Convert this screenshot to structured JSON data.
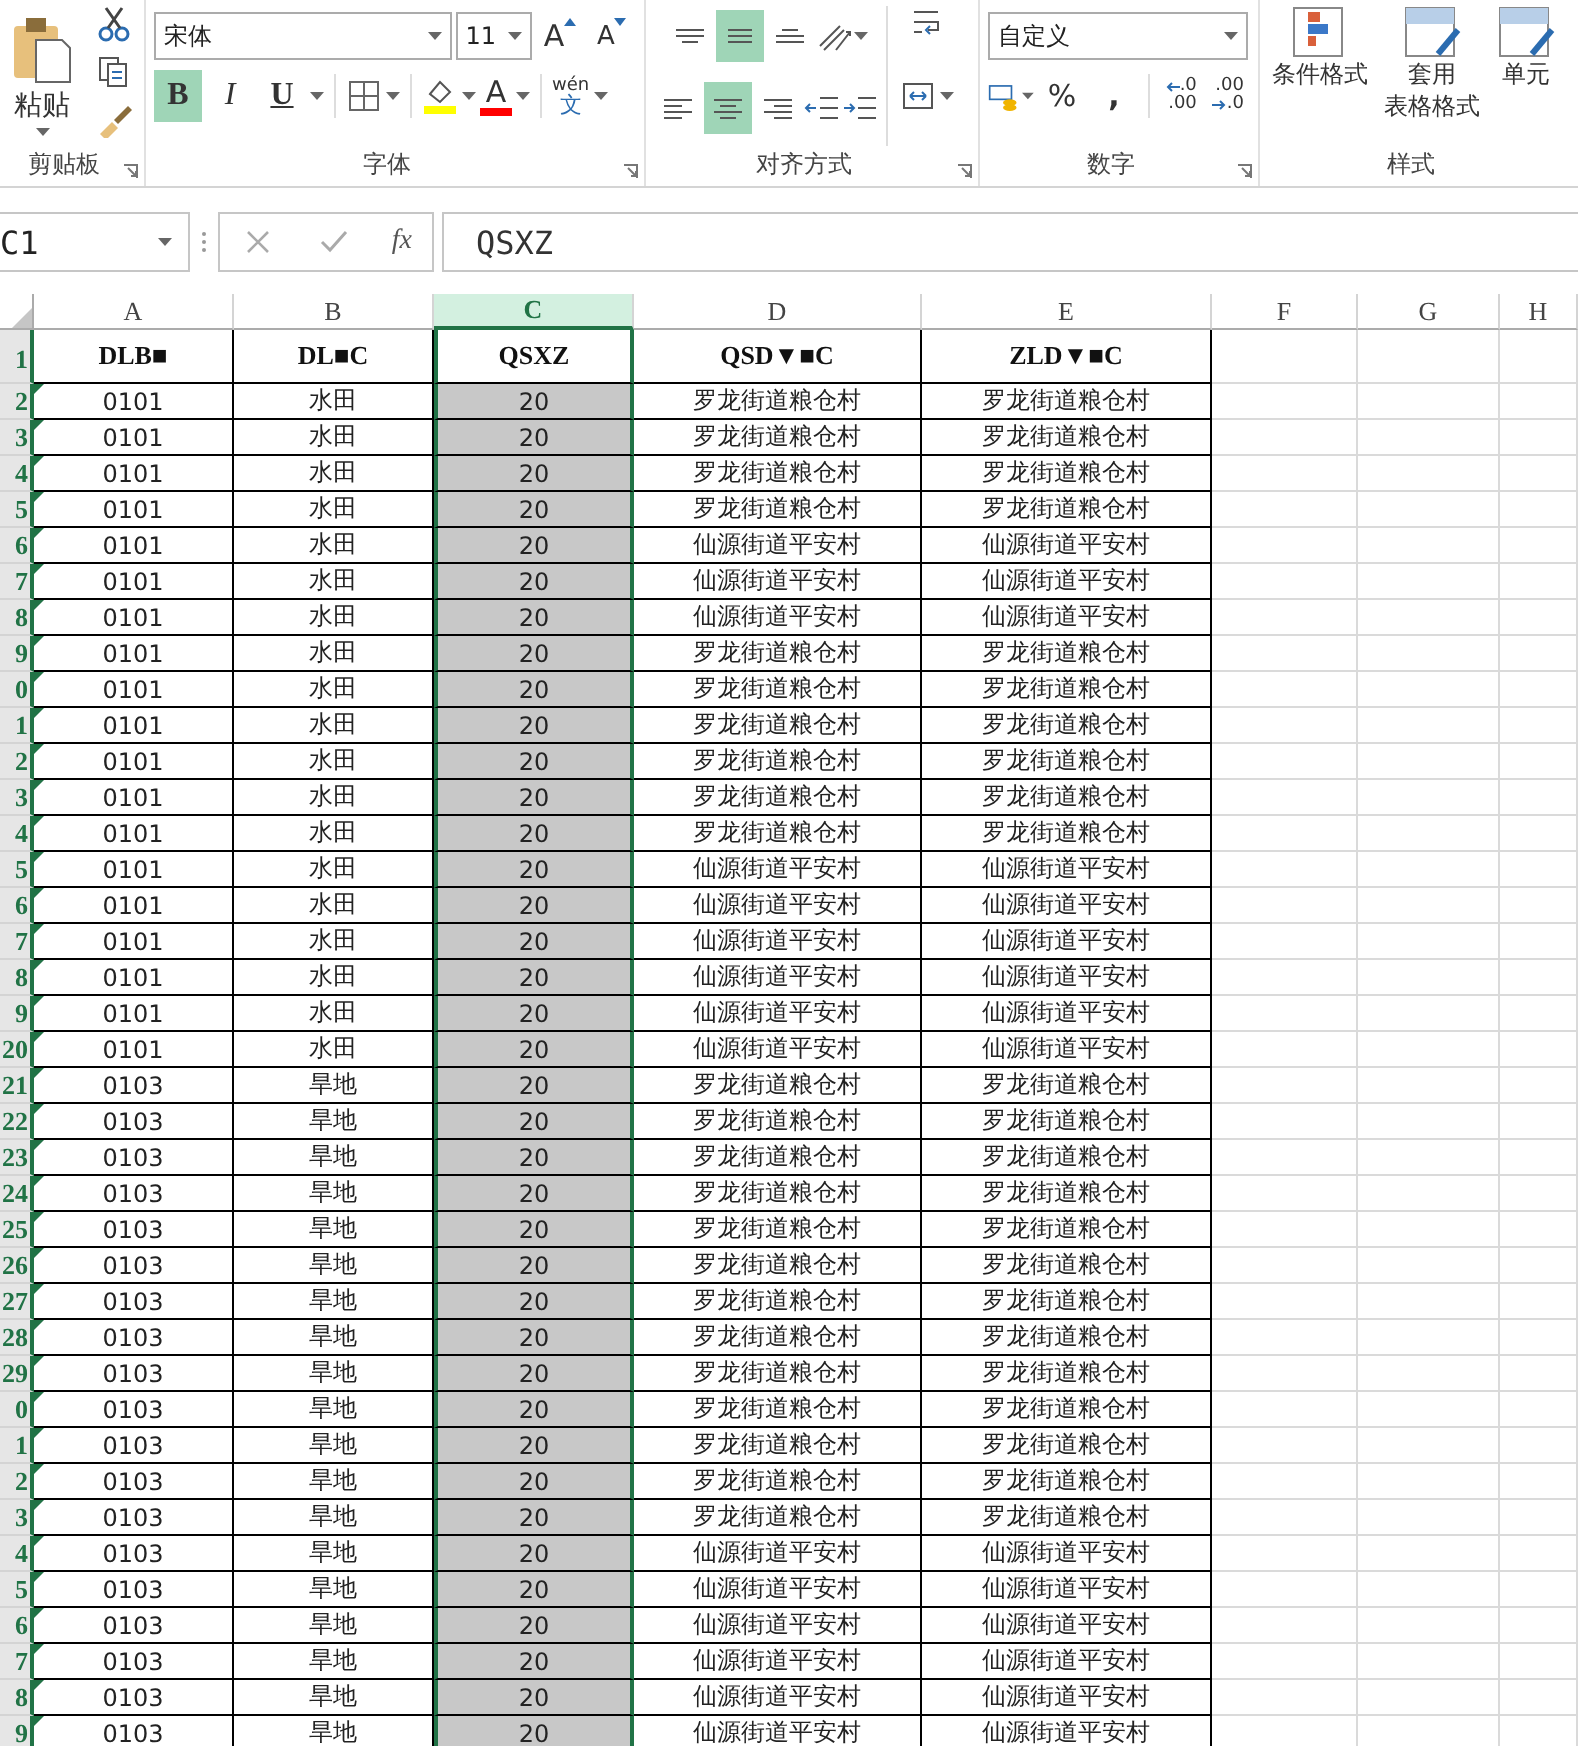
{
  "ribbon": {
    "clipboard": {
      "label": "剪贴板",
      "paste": "粘贴"
    },
    "font": {
      "label": "字体",
      "font_name": "宋体",
      "font_size": "11",
      "grow": "A",
      "shrink": "A",
      "bold": {
        "text": "B",
        "selected": true
      },
      "italic": {
        "text": "I",
        "selected": false
      },
      "underline": {
        "text": "U",
        "selected": false
      },
      "font_color": "A",
      "phonetic_top": "wén",
      "phonetic_bottom": "文"
    },
    "alignment": {
      "label": "对齐方式",
      "vertical": [
        {
          "kind": "top",
          "selected": false
        },
        {
          "kind": "middle",
          "selected": true
        },
        {
          "kind": "bottom",
          "selected": false
        }
      ],
      "horizontal": [
        {
          "kind": "left",
          "selected": false
        },
        {
          "kind": "center",
          "selected": true
        },
        {
          "kind": "right",
          "selected": false
        }
      ]
    },
    "number": {
      "label": "数字",
      "format": "自定义",
      "percent": "%",
      "comma": ",",
      "decimals": [
        {
          "kind": "increase",
          "top": ".0",
          "bottom": ".00"
        },
        {
          "kind": "decrease",
          "top": ".00",
          "bottom": ".0"
        }
      ]
    },
    "styles": {
      "label": "样式",
      "buttons": [
        {
          "kind": "conditional",
          "lines": [
            "条件格式"
          ]
        },
        {
          "kind": "table",
          "lines": [
            "套用",
            "表格格式"
          ]
        },
        {
          "kind": "cell",
          "lines": [
            "单元"
          ]
        }
      ]
    }
  },
  "formula_bar": {
    "name_box": "C1",
    "function_label": "fx",
    "content": "QSXZ"
  },
  "columns": [
    {
      "letter": "A",
      "selected": false,
      "shaded": false
    },
    {
      "letter": "B",
      "selected": false,
      "shaded": false
    },
    {
      "letter": "C",
      "selected": true,
      "shaded": true
    },
    {
      "letter": "D",
      "selected": false,
      "shaded": false
    },
    {
      "letter": "E",
      "selected": false,
      "shaded": false
    },
    {
      "letter": "F",
      "selected": false,
      "shaded": false
    },
    {
      "letter": "G",
      "selected": false,
      "shaded": false
    },
    {
      "letter": "H",
      "selected": false,
      "shaded": false
    }
  ],
  "rows": [
    {
      "number": "1",
      "kind": "header",
      "flag": false,
      "cells": [
        "DLB■",
        "DL■C",
        "QSXZ",
        "QSD▼■C",
        "ZLD▼■C"
      ]
    },
    {
      "number": "2",
      "kind": "data",
      "flag": true,
      "cells": [
        "0101",
        "水田",
        "20",
        "罗龙街道粮仓村",
        "罗龙街道粮仓村"
      ]
    },
    {
      "number": "3",
      "kind": "data",
      "flag": true,
      "cells": [
        "0101",
        "水田",
        "20",
        "罗龙街道粮仓村",
        "罗龙街道粮仓村"
      ]
    },
    {
      "number": "4",
      "kind": "data",
      "flag": true,
      "cells": [
        "0101",
        "水田",
        "20",
        "罗龙街道粮仓村",
        "罗龙街道粮仓村"
      ]
    },
    {
      "number": "5",
      "kind": "data",
      "flag": true,
      "cells": [
        "0101",
        "水田",
        "20",
        "罗龙街道粮仓村",
        "罗龙街道粮仓村"
      ]
    },
    {
      "number": "6",
      "kind": "data",
      "flag": true,
      "cells": [
        "0101",
        "水田",
        "20",
        "仙源街道平安村",
        "仙源街道平安村"
      ]
    },
    {
      "number": "7",
      "kind": "data",
      "flag": true,
      "cells": [
        "0101",
        "水田",
        "20",
        "仙源街道平安村",
        "仙源街道平安村"
      ]
    },
    {
      "number": "8",
      "kind": "data",
      "flag": true,
      "cells": [
        "0101",
        "水田",
        "20",
        "仙源街道平安村",
        "仙源街道平安村"
      ]
    },
    {
      "number": "9",
      "kind": "data",
      "flag": true,
      "cells": [
        "0101",
        "水田",
        "20",
        "罗龙街道粮仓村",
        "罗龙街道粮仓村"
      ]
    },
    {
      "number": "0",
      "kind": "data",
      "flag": true,
      "cells": [
        "0101",
        "水田",
        "20",
        "罗龙街道粮仓村",
        "罗龙街道粮仓村"
      ]
    },
    {
      "number": "1",
      "kind": "data",
      "flag": true,
      "cells": [
        "0101",
        "水田",
        "20",
        "罗龙街道粮仓村",
        "罗龙街道粮仓村"
      ]
    },
    {
      "number": "2",
      "kind": "data",
      "flag": true,
      "cells": [
        "0101",
        "水田",
        "20",
        "罗龙街道粮仓村",
        "罗龙街道粮仓村"
      ]
    },
    {
      "number": "3",
      "kind": "data",
      "flag": true,
      "cells": [
        "0101",
        "水田",
        "20",
        "罗龙街道粮仓村",
        "罗龙街道粮仓村"
      ]
    },
    {
      "number": "4",
      "kind": "data",
      "flag": true,
      "cells": [
        "0101",
        "水田",
        "20",
        "罗龙街道粮仓村",
        "罗龙街道粮仓村"
      ]
    },
    {
      "number": "5",
      "kind": "data",
      "flag": true,
      "cells": [
        "0101",
        "水田",
        "20",
        "仙源街道平安村",
        "仙源街道平安村"
      ]
    },
    {
      "number": "6",
      "kind": "data",
      "flag": true,
      "cells": [
        "0101",
        "水田",
        "20",
        "仙源街道平安村",
        "仙源街道平安村"
      ]
    },
    {
      "number": "7",
      "kind": "data",
      "flag": true,
      "cells": [
        "0101",
        "水田",
        "20",
        "仙源街道平安村",
        "仙源街道平安村"
      ]
    },
    {
      "number": "8",
      "kind": "data",
      "flag": true,
      "cells": [
        "0101",
        "水田",
        "20",
        "仙源街道平安村",
        "仙源街道平安村"
      ]
    },
    {
      "number": "9",
      "kind": "data",
      "flag": true,
      "cells": [
        "0101",
        "水田",
        "20",
        "仙源街道平安村",
        "仙源街道平安村"
      ]
    },
    {
      "number": "20",
      "kind": "data",
      "flag": true,
      "cells": [
        "0101",
        "水田",
        "20",
        "仙源街道平安村",
        "仙源街道平安村"
      ]
    },
    {
      "number": "21",
      "kind": "data",
      "flag": true,
      "cells": [
        "0103",
        "旱地",
        "20",
        "罗龙街道粮仓村",
        "罗龙街道粮仓村"
      ]
    },
    {
      "number": "22",
      "kind": "data",
      "flag": true,
      "cells": [
        "0103",
        "旱地",
        "20",
        "罗龙街道粮仓村",
        "罗龙街道粮仓村"
      ]
    },
    {
      "number": "23",
      "kind": "data",
      "flag": true,
      "cells": [
        "0103",
        "旱地",
        "20",
        "罗龙街道粮仓村",
        "罗龙街道粮仓村"
      ]
    },
    {
      "number": "24",
      "kind": "data",
      "flag": true,
      "cells": [
        "0103",
        "旱地",
        "20",
        "罗龙街道粮仓村",
        "罗龙街道粮仓村"
      ]
    },
    {
      "number": "25",
      "kind": "data",
      "flag": true,
      "cells": [
        "0103",
        "旱地",
        "20",
        "罗龙街道粮仓村",
        "罗龙街道粮仓村"
      ]
    },
    {
      "number": "26",
      "kind": "data",
      "flag": true,
      "cells": [
        "0103",
        "旱地",
        "20",
        "罗龙街道粮仓村",
        "罗龙街道粮仓村"
      ]
    },
    {
      "number": "27",
      "kind": "data",
      "flag": true,
      "cells": [
        "0103",
        "旱地",
        "20",
        "罗龙街道粮仓村",
        "罗龙街道粮仓村"
      ]
    },
    {
      "number": "28",
      "kind": "data",
      "flag": true,
      "cells": [
        "0103",
        "旱地",
        "20",
        "罗龙街道粮仓村",
        "罗龙街道粮仓村"
      ]
    },
    {
      "number": "29",
      "kind": "data",
      "flag": true,
      "cells": [
        "0103",
        "旱地",
        "20",
        "罗龙街道粮仓村",
        "罗龙街道粮仓村"
      ]
    },
    {
      "number": "0",
      "kind": "data",
      "flag": true,
      "cells": [
        "0103",
        "旱地",
        "20",
        "罗龙街道粮仓村",
        "罗龙街道粮仓村"
      ]
    },
    {
      "number": "1",
      "kind": "data",
      "flag": true,
      "cells": [
        "0103",
        "旱地",
        "20",
        "罗龙街道粮仓村",
        "罗龙街道粮仓村"
      ]
    },
    {
      "number": "2",
      "kind": "data",
      "flag": true,
      "cells": [
        "0103",
        "旱地",
        "20",
        "罗龙街道粮仓村",
        "罗龙街道粮仓村"
      ]
    },
    {
      "number": "3",
      "kind": "data",
      "flag": true,
      "cells": [
        "0103",
        "旱地",
        "20",
        "罗龙街道粮仓村",
        "罗龙街道粮仓村"
      ]
    },
    {
      "number": "4",
      "kind": "data",
      "flag": true,
      "cells": [
        "0103",
        "旱地",
        "20",
        "仙源街道平安村",
        "仙源街道平安村"
      ]
    },
    {
      "number": "5",
      "kind": "data",
      "flag": true,
      "cells": [
        "0103",
        "旱地",
        "20",
        "仙源街道平安村",
        "仙源街道平安村"
      ]
    },
    {
      "number": "6",
      "kind": "data",
      "flag": true,
      "cells": [
        "0103",
        "旱地",
        "20",
        "仙源街道平安村",
        "仙源街道平安村"
      ]
    },
    {
      "number": "7",
      "kind": "data",
      "flag": true,
      "cells": [
        "0103",
        "旱地",
        "20",
        "仙源街道平安村",
        "仙源街道平安村"
      ]
    },
    {
      "number": "8",
      "kind": "data",
      "flag": true,
      "cells": [
        "0103",
        "旱地",
        "20",
        "仙源街道平安村",
        "仙源街道平安村"
      ]
    },
    {
      "number": "9",
      "kind": "data",
      "flag": true,
      "cells": [
        "0103",
        "旱地",
        "20",
        "仙源街道平安村",
        "仙源街道平安村"
      ]
    }
  ]
}
